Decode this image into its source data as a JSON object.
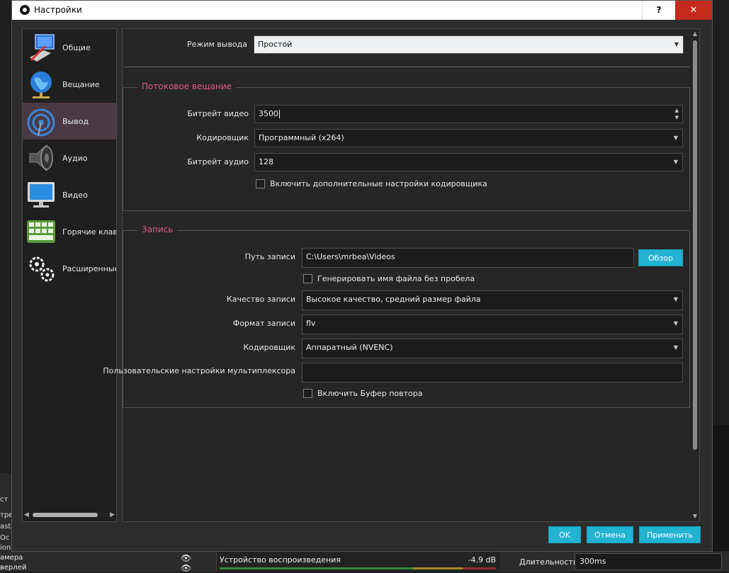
{
  "window": {
    "title": "Настройки",
    "help_label": "?",
    "close_label": "✕"
  },
  "sidebar": {
    "items": [
      {
        "label": "Общие",
        "icon": "general-icon"
      },
      {
        "label": "Вещание",
        "icon": "broadcast-globe-icon"
      },
      {
        "label": "Вывод",
        "icon": "output-signal-icon",
        "active": true
      },
      {
        "label": "Аудио",
        "icon": "speaker-icon"
      },
      {
        "label": "Видео",
        "icon": "monitor-icon"
      },
      {
        "label": "Горячие клави",
        "icon": "keyboard-icon"
      },
      {
        "label": "Расширенные",
        "icon": "gears-icon"
      }
    ]
  },
  "output": {
    "mode_label": "Режим вывода",
    "mode_value": "Простой",
    "streaming": {
      "title": "Потоковое вещание",
      "video_bitrate_label": "Битрейт видео",
      "video_bitrate_value": "3500",
      "encoder_label": "Кодировщик",
      "encoder_value": "Программный (x264)",
      "audio_bitrate_label": "Битрейт аудио",
      "audio_bitrate_value": "128",
      "advanced_encoder_label": "Включить дополнительные настройки кодировщика"
    },
    "recording": {
      "title": "Запись",
      "path_label": "Путь записи",
      "path_value": "C:\\Users\\mrbea\\Videos",
      "browse_label": "Обзор",
      "no_space_label": "Генерировать имя файла без пробела",
      "quality_label": "Качество записи",
      "quality_value": "Высокое качество, средний размер файла",
      "format_label": "Формат записи",
      "format_value": "flv",
      "encoder_label": "Кодировщик",
      "encoder_value": "Аппаратный (NVENC)",
      "muxer_label": "Пользовательские настройки мультиплексора",
      "muxer_value": "",
      "replay_buffer_label": "Включить Буфер повтора"
    }
  },
  "buttons": {
    "ok": "OK",
    "cancel": "Отмена",
    "apply": "Применить"
  },
  "background": {
    "left_lines": [
      "ст",
      "тре",
      "ast",
      "Ос",
      "ion"
    ],
    "scene1": "амера",
    "scene2": "верлей",
    "audio_device": "Устройство воспроизведения",
    "audio_db": "-4.9 dB",
    "duration_label": "Длительность",
    "duration_value": "300ms"
  },
  "colors": {
    "accent": "#22b3d3",
    "group_title": "#e05a8a",
    "active_item": "#4b3a44"
  }
}
